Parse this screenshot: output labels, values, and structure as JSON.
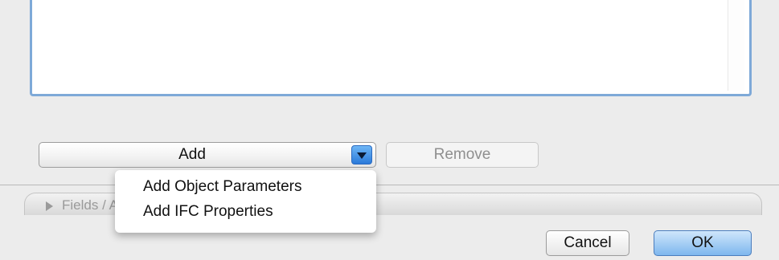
{
  "add_popup": {
    "label": "Add"
  },
  "remove_button": {
    "label": "Remove"
  },
  "section": {
    "title": "Fields / Attributen"
  },
  "menu": {
    "items": [
      {
        "label": "Add Object Parameters"
      },
      {
        "label": "Add IFC Properties"
      }
    ]
  },
  "footer": {
    "cancel_label": "Cancel",
    "ok_label": "OK"
  },
  "colors": {
    "focus_ring": "#7ea9d8",
    "accent": "#2a79d9"
  }
}
